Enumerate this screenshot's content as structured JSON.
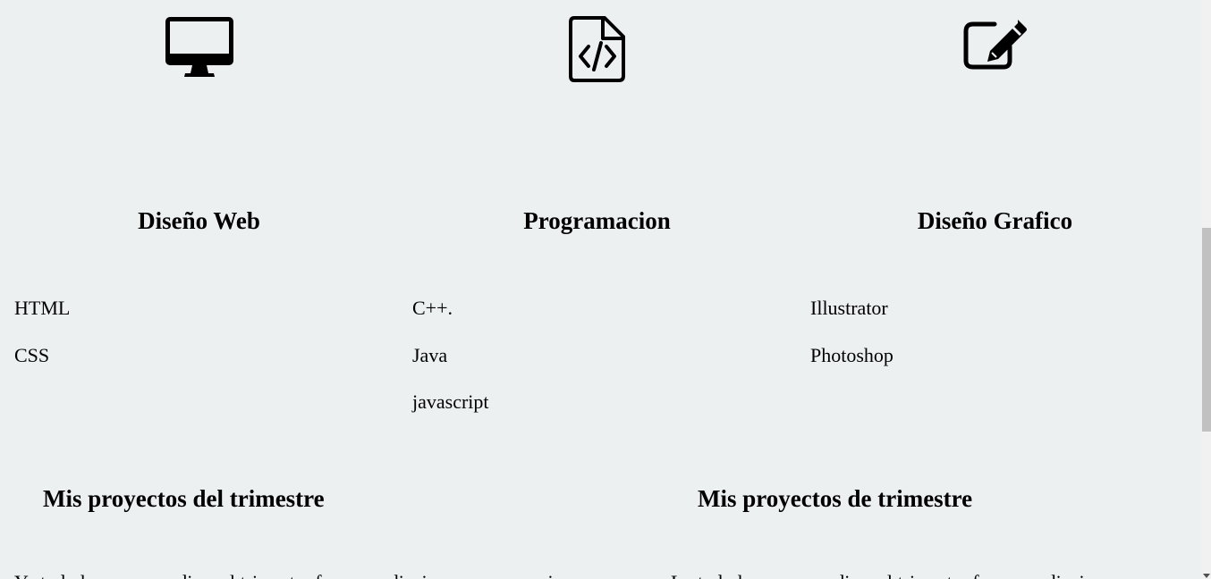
{
  "services": [
    {
      "icon": "desktop-icon",
      "title": "Diseño Web",
      "items": [
        "HTML",
        "CSS"
      ]
    },
    {
      "icon": "file-code-icon",
      "title": "Programacion",
      "items": [
        "C++.",
        "Java",
        "javascript"
      ]
    },
    {
      "icon": "pen-to-square-icon",
      "title": "Diseño Grafico",
      "items": [
        "Illustrator",
        "Photoshop"
      ]
    }
  ],
  "projects": {
    "left": {
      "title": "Mis proyectos del trimestre",
      "text_partial": "Ya todo lo que aprendi en el trimestre fue aprendizaje nuevo para mi"
    },
    "right": {
      "title": "Mis proyectos de trimestre",
      "text_partial": "Lo todo lo que aprendi en el trimestre fue aprendizaje nuevo para mi"
    }
  }
}
